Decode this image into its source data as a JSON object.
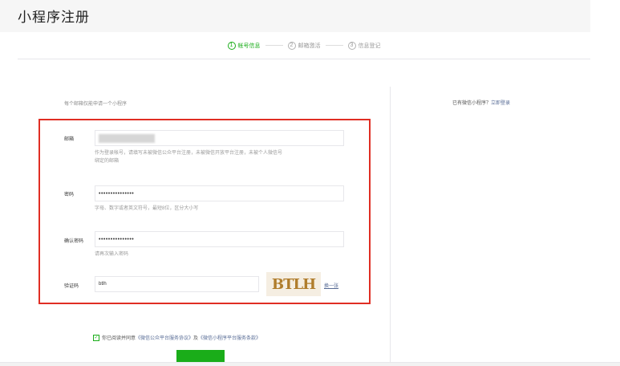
{
  "page": {
    "title": "小程序注册"
  },
  "steps": [
    {
      "num": "1",
      "label": "帐号信息",
      "active": true
    },
    {
      "num": "2",
      "label": "邮箱激活",
      "active": false
    },
    {
      "num": "3",
      "label": "信息登记",
      "active": false
    }
  ],
  "form": {
    "notice": "每个邮箱仅能申请一个小程序",
    "email": {
      "label": "邮箱",
      "hint_line1": "作为登录帐号，请填写未被微信公众平台注册，未被微信开放平台注册，未被个人微信号",
      "hint_line2": "绑定的邮箱"
    },
    "password": {
      "label": "密码",
      "value": "•••••••••••••••",
      "hint": "字母、数字或者英文符号，最短8位，区分大小写"
    },
    "confirm": {
      "label": "确认密码",
      "value": "•••••••••••••••",
      "hint": "请再次输入密码"
    },
    "captcha": {
      "label": "验证码",
      "value": "btlh",
      "image_text": "BTLH",
      "refresh": "换一张"
    },
    "agree": {
      "prefix": "你已阅读并同意",
      "link1": "《微信公众平台服务协议》",
      "middle": "及",
      "link2": "《微信小程序平台服务条款》"
    }
  },
  "side": {
    "hint": "已有微信小程序？",
    "login_link": "立即登录"
  }
}
